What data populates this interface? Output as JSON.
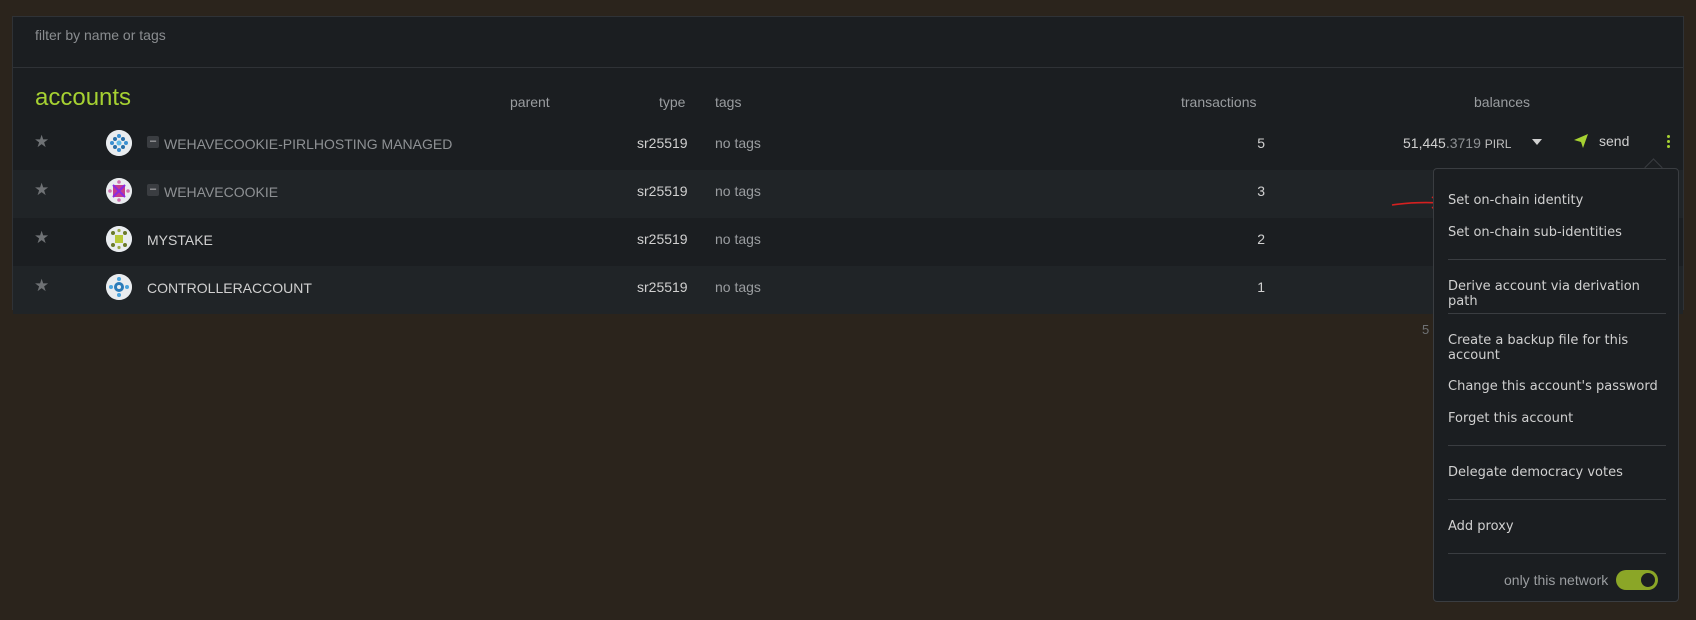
{
  "filter": {
    "placeholder": "filter by name or tags"
  },
  "table": {
    "title": "accounts",
    "headers": {
      "parent": "parent",
      "type": "type",
      "tags": "tags",
      "transactions": "transactions",
      "balances": "balances"
    }
  },
  "accounts": [
    {
      "name": "WEHAVECOOKIE-PIRLHOSTING MANAGED",
      "type": "sr25519",
      "tags": "no tags",
      "transactions": "5",
      "balance_int": "51,445",
      "balance_frac": ".3719",
      "balance_unit": "PIRL",
      "send_label": "send"
    },
    {
      "name": "WEHAVECOOKIE",
      "type": "sr25519",
      "tags": "no tags",
      "transactions": "3"
    },
    {
      "name": "MYSTAKE",
      "type": "sr25519",
      "tags": "no tags",
      "transactions": "2"
    },
    {
      "name": "CONTROLLERACCOUNT",
      "type": "sr25519",
      "tags": "no tags",
      "transactions": "1"
    }
  ],
  "footer_peek": "5",
  "menu": {
    "items": [
      "Set on-chain identity",
      "Set on-chain sub-identities",
      "Derive account via derivation path",
      "Create a backup file for this account",
      "Change this account's password",
      "Forget this account",
      "Delegate democracy votes",
      "Add proxy"
    ],
    "toggle_label": "only this network",
    "toggle_on": true
  },
  "colors": {
    "accent": "#a6d132",
    "toggle": "#8ba627",
    "background": "#2b241c",
    "panel": "#1b1e21",
    "annotation": "#d42020"
  },
  "icons": [
    "star-icon",
    "identicon",
    "minus-icon",
    "send-icon",
    "chevron-down-icon",
    "kebab-menu-icon",
    "arrow-annotation"
  ]
}
